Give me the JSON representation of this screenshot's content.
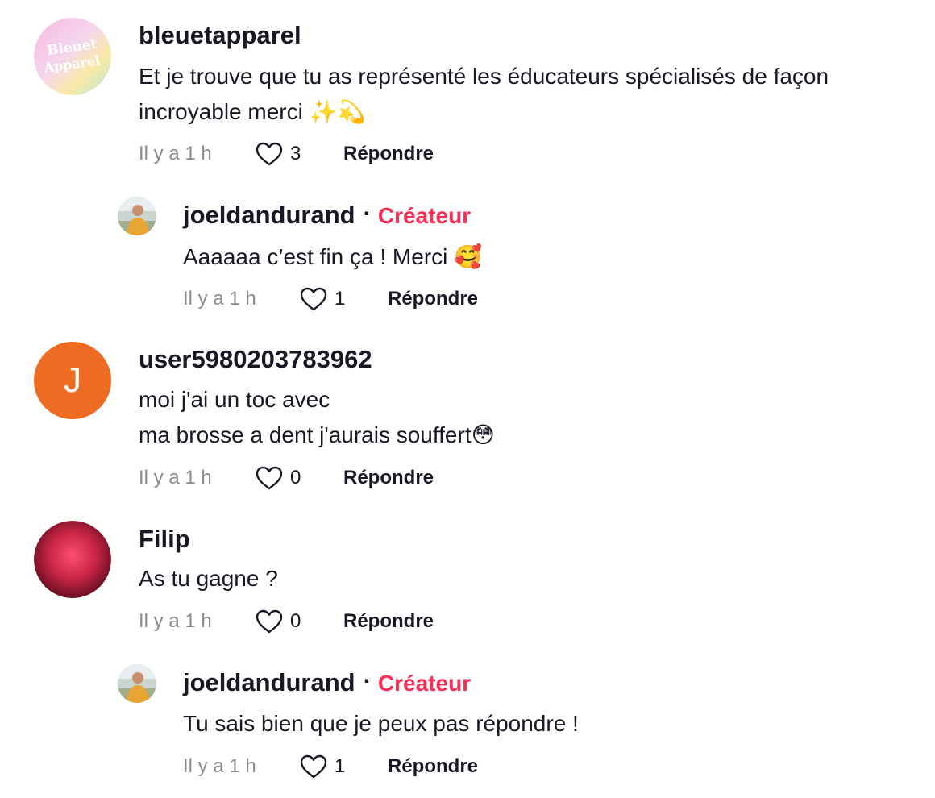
{
  "comments": [
    {
      "username": "bleuetapparel",
      "avatar_text": "Bleuet Apparel",
      "lines": [
        "Et je trouve que tu as représenté les éducateurs spécialisés de façon",
        "incroyable merci ✨💫"
      ],
      "time": "Il y a 1 h",
      "likes": "3",
      "reply": "Répondre"
    },
    {
      "username": "joeldandurand",
      "dot": "·",
      "badge": "Créateur",
      "lines": [
        "Aaaaaa c’est fin ça ! Merci 🥰"
      ],
      "time": "Il y a 1 h",
      "likes": "1",
      "reply": "Répondre"
    },
    {
      "username": "user5980203783962",
      "avatar_letter": "J",
      "lines": [
        "moi j'ai un toc avec",
        "ma brosse a dent j'aurais souffert😳"
      ],
      "time": "Il y a 1 h",
      "likes": "0",
      "reply": "Répondre"
    },
    {
      "username": "Filip",
      "lines": [
        "As tu gagne ?"
      ],
      "time": "Il y a 1 h",
      "likes": "0",
      "reply": "Répondre"
    },
    {
      "username": "joeldandurand",
      "dot": "·",
      "badge": "Créateur",
      "lines": [
        "Tu sais bien que je peux pas répondre !"
      ],
      "time": "Il y a 1 h",
      "likes": "1",
      "reply": "Répondre"
    }
  ],
  "colors": {
    "creator_badge": "#fe2c55",
    "text_primary": "#161823",
    "text_secondary": "#8a8b91",
    "avatar_orange": "#ee6b22"
  },
  "icons": {
    "like": "heart-outline-icon"
  }
}
